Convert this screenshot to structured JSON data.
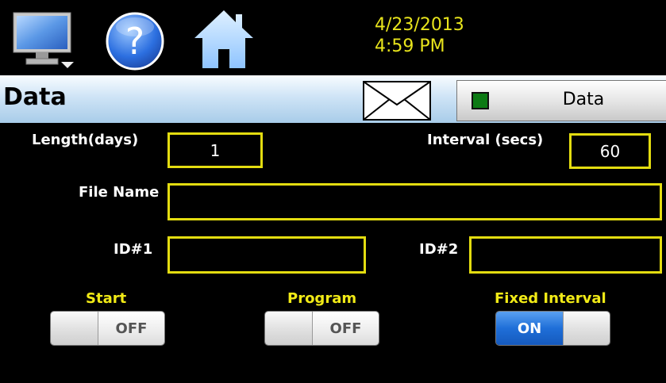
{
  "header": {
    "date": "4/23/2013",
    "time": "4:59 PM"
  },
  "icons": {
    "monitor": "monitor-icon",
    "help": "help-icon",
    "home": "home-icon",
    "mail": "mail-icon"
  },
  "titlebar": {
    "title": "Data",
    "data_button_label": "Data",
    "data_led_color": "#0c7a14"
  },
  "form": {
    "length_label": "Length(days)",
    "length_value": "1",
    "interval_label": "Interval (secs)",
    "interval_value": "60",
    "file_name_label": "File Name",
    "file_name_value": "",
    "id1_label": "ID#1",
    "id1_value": "",
    "id2_label": "ID#2",
    "id2_value": ""
  },
  "toggles": {
    "start": {
      "label": "Start",
      "state": "OFF"
    },
    "program": {
      "label": "Program",
      "state": "OFF"
    },
    "fixed_interval": {
      "label": "Fixed Interval",
      "state": "ON"
    }
  },
  "colors": {
    "accent_yellow": "#e3dc10",
    "background": "#000000",
    "toggle_on_blue": "#1f6fd8"
  }
}
